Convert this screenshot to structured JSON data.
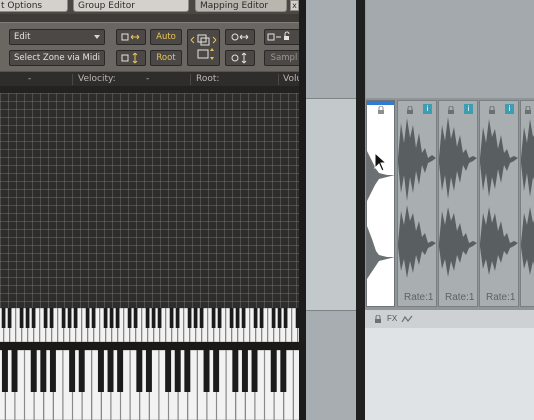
{
  "tabs": [
    {
      "label": "t Options"
    },
    {
      "label": "Group Editor"
    },
    {
      "label": "Mapping Editor"
    }
  ],
  "tab_close": "x",
  "toolbar": {
    "edit_label": "Edit",
    "select_zone_label": "Select Zone via Midi",
    "auto_label": "Auto",
    "root_label": "Root",
    "sample_label": "Sampl"
  },
  "infobar": {
    "dash1": "-",
    "velocity_label": "Velocity:",
    "dash2": "-",
    "root_label": "Root:",
    "volume_label": "Volu"
  },
  "clips": [
    {
      "rate": ""
    },
    {
      "rate": "Rate:1"
    },
    {
      "rate": "Rate:1"
    },
    {
      "rate": "Rate:1"
    },
    {
      "rate": ""
    }
  ],
  "info_badge": "i",
  "footer": {
    "fx_label": "FX"
  },
  "colors": {
    "accent": "#2f7bd6",
    "badge": "#3e9db1",
    "tool_yellow": "#e9c35a"
  }
}
